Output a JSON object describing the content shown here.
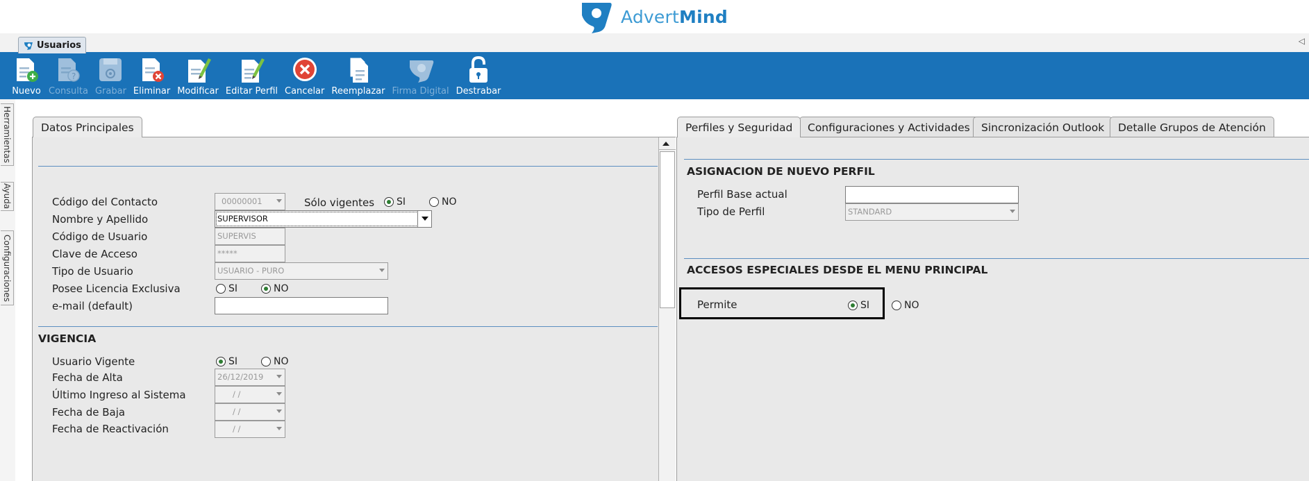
{
  "brand": {
    "name_regular": "Advert",
    "name_bold": "Mind"
  },
  "window_tab": {
    "label": "Usuarios"
  },
  "toolbar": {
    "buttons": [
      {
        "label": "Nuevo",
        "icon": "doc-add-icon",
        "enabled": true
      },
      {
        "label": "Consulta",
        "icon": "doc-query-icon",
        "enabled": false
      },
      {
        "label": "Grabar",
        "icon": "save-icon",
        "enabled": false
      },
      {
        "label": "Eliminar",
        "icon": "doc-delete-icon",
        "enabled": true
      },
      {
        "label": "Modificar",
        "icon": "doc-edit-icon",
        "enabled": true
      },
      {
        "label": "Editar Perfil",
        "icon": "profile-edit-icon",
        "enabled": true
      },
      {
        "label": "Cancelar",
        "icon": "cancel-icon",
        "enabled": true
      },
      {
        "label": "Reemplazar",
        "icon": "replace-icon",
        "enabled": true
      },
      {
        "label": "Firma Digital",
        "icon": "digital-signature-icon",
        "enabled": false
      },
      {
        "label": "Destrabar",
        "icon": "unlock-icon",
        "enabled": true
      }
    ]
  },
  "side_tabs": [
    "Herramientas",
    "Ayuda",
    "Configuraciones"
  ],
  "left_panel": {
    "tab": "Datos Principales",
    "fields": {
      "codigo_contacto": {
        "label": "Código del Contacto",
        "value": "00000001"
      },
      "solo_vigentes": {
        "label": "Sólo vigentes",
        "yes": "SI",
        "no": "NO",
        "selected": "SI"
      },
      "nombre_apellido": {
        "label": "Nombre y Apellido",
        "value": "SUPERVISOR"
      },
      "codigo_usuario": {
        "label": "Código de Usuario",
        "value": "SUPERVIS"
      },
      "clave_acceso": {
        "label": "Clave de Acceso",
        "value": "*****"
      },
      "tipo_usuario": {
        "label": "Tipo de Usuario",
        "value": "USUARIO - PURO"
      },
      "licencia_exclusiva": {
        "label": "Posee Licencia Exclusiva",
        "yes": "SI",
        "no": "NO",
        "selected": "NO"
      },
      "email": {
        "label": "e-mail (default)",
        "value": ""
      }
    },
    "vigencia": {
      "title": "VIGENCIA",
      "usuario_vigente": {
        "label": "Usuario Vigente",
        "yes": "SI",
        "no": "NO",
        "selected": "SI"
      },
      "fecha_alta": {
        "label": "Fecha de Alta",
        "value": "26/12/2019"
      },
      "ultimo_ingreso": {
        "label": "Último Ingreso al Sistema",
        "value": "/ /"
      },
      "fecha_baja": {
        "label": "Fecha de Baja",
        "value": "/ /"
      },
      "fecha_reactivacion": {
        "label": "Fecha de Reactivación",
        "value": "/ /"
      }
    }
  },
  "right_panel": {
    "tabs": [
      "Perfiles y Seguridad",
      "Configuraciones y Actividades",
      "Sincronización Outlook",
      "Detalle Grupos de Atención"
    ],
    "asignacion": {
      "title": "ASIGNACION DE NUEVO PERFIL",
      "perfil_base": {
        "label": "Perfil Base actual",
        "value": ""
      },
      "tipo_perfil": {
        "label": "Tipo de Perfil",
        "value": "STANDARD"
      }
    },
    "accesos": {
      "title": "ACCESOS ESPECIALES DESDE EL MENU PRINCIPAL",
      "permite": {
        "label": "Permite",
        "yes": "SI",
        "no": "NO",
        "selected": "SI"
      }
    }
  },
  "colors": {
    "toolbar_bg": "#1a72b8",
    "brand_blue": "#3d9bd4",
    "panel_bg": "#e9e9e9"
  }
}
